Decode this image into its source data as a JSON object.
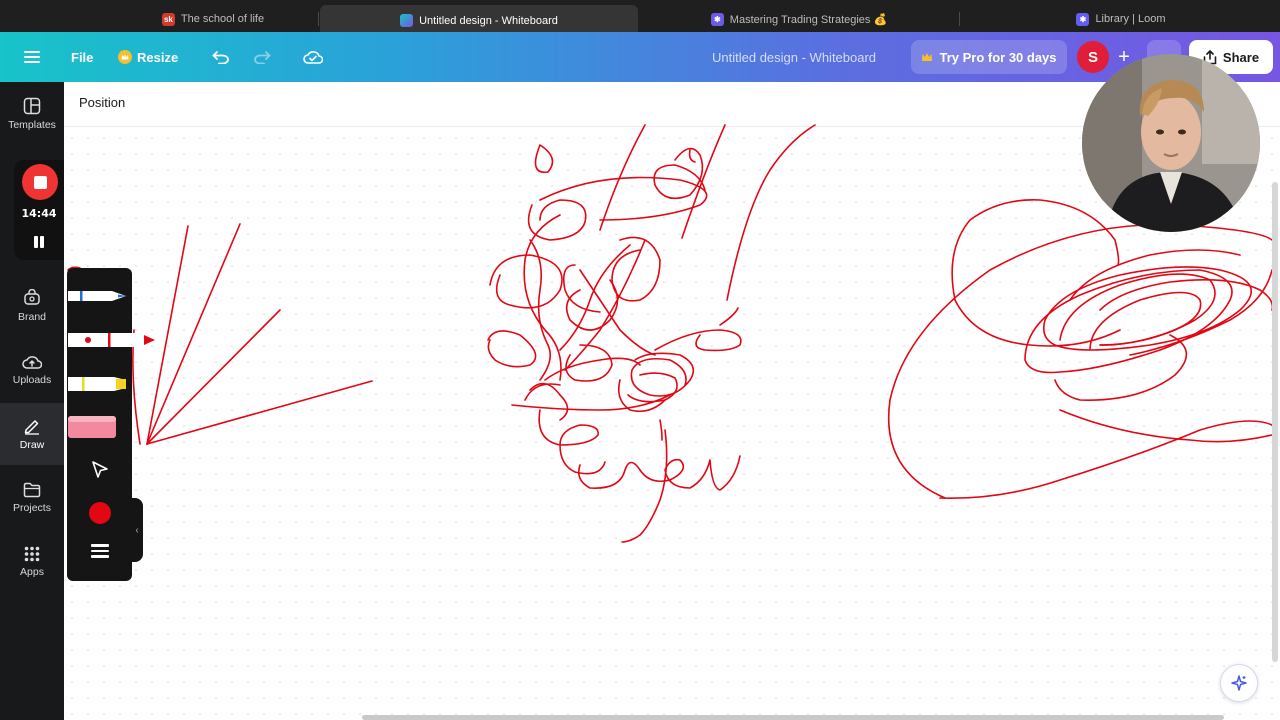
{
  "browser": {
    "tabs": [
      {
        "label": "The school of life",
        "favicon": "sk",
        "active": false
      },
      {
        "label": "Untitled design - Whiteboard",
        "favicon": "canva",
        "active": true
      },
      {
        "label": "Mastering Trading Strategies 💰",
        "favicon": "clickup",
        "active": false
      },
      {
        "label": "Library | Loom",
        "favicon": "loom",
        "active": false
      }
    ]
  },
  "header": {
    "menu_icon": "hamburger-icon",
    "file_label": "File",
    "resize_label": "Resize",
    "doc_title": "Untitled design - Whiteboard",
    "pro_label": "Try Pro for 30 days",
    "avatar_initial": "S",
    "share_label": "Share"
  },
  "sidebar": {
    "items": [
      {
        "label": "Templates",
        "icon": "templates-icon"
      },
      {
        "label": "Brand",
        "icon": "brand-icon"
      },
      {
        "label": "Uploads",
        "icon": "uploads-icon"
      },
      {
        "label": "Draw",
        "icon": "draw-icon",
        "active": true
      },
      {
        "label": "Projects",
        "icon": "projects-icon"
      },
      {
        "label": "Apps",
        "icon": "apps-icon"
      }
    ]
  },
  "recorder": {
    "timer": "14:44"
  },
  "canvas": {
    "toolbar_label": "Position",
    "stroke_color": "#e30613"
  },
  "draw_tools": {
    "selected_color": "#e30613",
    "tools": [
      "pen-tool",
      "marker-tool",
      "highlighter-tool",
      "eraser-tool",
      "select-tool"
    ]
  },
  "colors": {
    "header_start": "#18c3c9",
    "header_end": "#7656e3",
    "sidebar_bg": "#18191b",
    "record_red": "#f03434"
  }
}
